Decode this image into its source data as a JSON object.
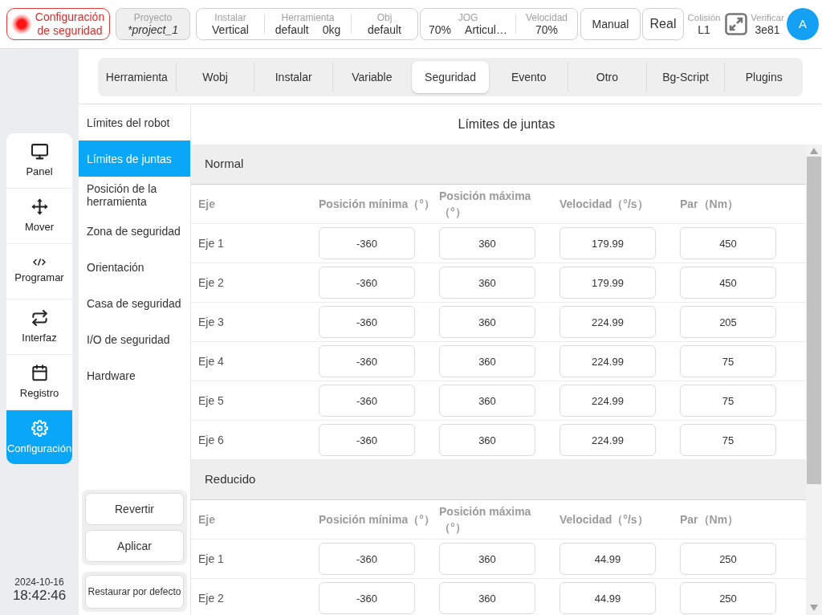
{
  "top_bar": {
    "safety_button": "Configuración de seguridad",
    "project": {
      "label": "Proyecto",
      "value": "*project_1"
    },
    "install_info": [
      {
        "label": "Instalar",
        "values": [
          "Vertical"
        ]
      },
      {
        "label": "Herramienta",
        "values": [
          "default",
          "0kg"
        ]
      },
      {
        "label": "Obj",
        "values": [
          "default"
        ]
      }
    ],
    "jog_info": [
      {
        "label": "JOG",
        "values": [
          "70%",
          "Articul…"
        ]
      },
      {
        "label": "Velocidad",
        "values": [
          "70%"
        ]
      }
    ],
    "mode_buttons": [
      "Manual",
      "Real"
    ],
    "collision": {
      "label": "Colisión",
      "value": "L1"
    },
    "verify": {
      "label": "Verificar",
      "value": "3e81"
    },
    "avatar": "A"
  },
  "sidebar": {
    "items": [
      {
        "label": "Panel",
        "selected": false
      },
      {
        "label": "Mover",
        "selected": false
      },
      {
        "label": "Programar",
        "selected": false
      },
      {
        "label": "Interfaz",
        "selected": false
      },
      {
        "label": "Registro",
        "selected": false
      },
      {
        "label": "Configuración",
        "selected": true
      }
    ]
  },
  "clock": {
    "date": "2024-10-16",
    "time": "18:42:46"
  },
  "tabs": [
    {
      "label": "Herramienta",
      "selected": false
    },
    {
      "label": "Wobj",
      "selected": false
    },
    {
      "label": "Instalar",
      "selected": false
    },
    {
      "label": "Variable",
      "selected": false
    },
    {
      "label": "Seguridad",
      "selected": true
    },
    {
      "label": "Evento",
      "selected": false
    },
    {
      "label": "Otro",
      "selected": false
    },
    {
      "label": "Bg-Script",
      "selected": false
    },
    {
      "label": "Plugins",
      "selected": false
    }
  ],
  "submenu": {
    "items": [
      {
        "label": "Límites del robot",
        "selected": false
      },
      {
        "label": "Límites de juntas",
        "selected": true
      },
      {
        "label": "Posición de la herramienta",
        "selected": false
      },
      {
        "label": "Zona de seguridad",
        "selected": false
      },
      {
        "label": "Orientación",
        "selected": false
      },
      {
        "label": "Casa de seguridad",
        "selected": false
      },
      {
        "label": "I/O de seguridad",
        "selected": false
      },
      {
        "label": "Hardware",
        "selected": false
      }
    ],
    "buttons": [
      "Revertir",
      "Aplicar"
    ],
    "restore_button": "Restaurar por defecto"
  },
  "panel": {
    "title": "Límites de juntas",
    "sections": [
      {
        "title": "Normal",
        "columns": [
          "Eje",
          "Posición mínima（°）",
          "Posición máxima（°）",
          "Velocidad（°/s）",
          "Par（Nm）"
        ],
        "rows": [
          {
            "axis": "Eje 1",
            "values": [
              "-360",
              "360",
              "179.99",
              "450"
            ]
          },
          {
            "axis": "Eje 2",
            "values": [
              "-360",
              "360",
              "179.99",
              "450"
            ]
          },
          {
            "axis": "Eje 3",
            "values": [
              "-360",
              "360",
              "224.99",
              "205"
            ]
          },
          {
            "axis": "Eje 4",
            "values": [
              "-360",
              "360",
              "224.99",
              "75"
            ]
          },
          {
            "axis": "Eje 5",
            "values": [
              "-360",
              "360",
              "224.99",
              "75"
            ]
          },
          {
            "axis": "Eje 6",
            "values": [
              "-360",
              "360",
              "224.99",
              "75"
            ]
          }
        ]
      },
      {
        "title": "Reducido",
        "columns": [
          "Eje",
          "Posición mínima（°）",
          "Posición máxima（°）",
          "Velocidad（°/s）",
          "Par（Nm）"
        ],
        "rows": [
          {
            "axis": "Eje 1",
            "values": [
              "-360",
              "360",
              "44.99",
              "250"
            ]
          },
          {
            "axis": "Eje 2",
            "values": [
              "-360",
              "360",
              "44.99",
              "250"
            ]
          }
        ]
      }
    ]
  }
}
